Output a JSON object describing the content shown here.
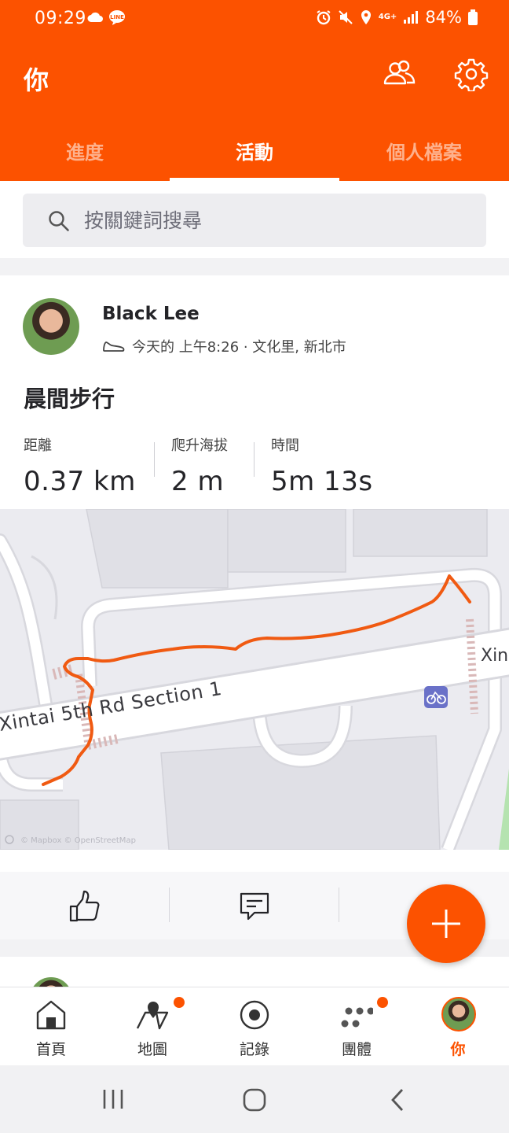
{
  "status_bar": {
    "time": "09:29",
    "network": "4G+",
    "battery": "84%"
  },
  "header": {
    "title": "你"
  },
  "tabs": [
    {
      "label": "進度",
      "active": false
    },
    {
      "label": "活動",
      "active": true
    },
    {
      "label": "個人檔案",
      "active": false
    }
  ],
  "search": {
    "placeholder": "按關鍵詞搜尋"
  },
  "activity": {
    "athlete_name": "Black Lee",
    "meta": "今天的 上午8:26 · 文化里, 新北市",
    "title": "晨間步行",
    "stats": [
      {
        "label": "距離",
        "value": "0.37 km"
      },
      {
        "label": "爬升海拔",
        "value": "2 m"
      },
      {
        "label": "時間",
        "value": "5m 13s"
      }
    ],
    "map": {
      "street_label": "Xintai 5th Rd Section 1",
      "street_label_right": "Xin",
      "attribution": "© Mapbox © OpenStreetMap"
    }
  },
  "bottom_nav": [
    {
      "label": "首頁",
      "active": false
    },
    {
      "label": "地圖",
      "active": false,
      "badge": true
    },
    {
      "label": "記錄",
      "active": false
    },
    {
      "label": "團體",
      "active": false,
      "badge": true
    },
    {
      "label": "你",
      "active": true
    }
  ],
  "colors": {
    "brand": "#fc5200",
    "route": "#f05a12"
  }
}
